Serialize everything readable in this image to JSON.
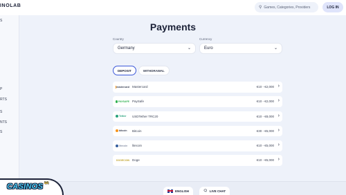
{
  "header": {
    "logo_text": "INOLAB",
    "search_placeholder": "Games, Categories, Providers",
    "search_icon": "search-icon",
    "login_label": "LOG IN"
  },
  "sidebar": {
    "fragments": [
      "S",
      "P",
      "RTS",
      "S",
      "NTS",
      "S"
    ]
  },
  "main": {
    "title": "Payments",
    "country_label": "Country",
    "country_value": "Germany",
    "currency_label": "Currency",
    "currency_value": "Euro",
    "tabs": [
      {
        "label": "DEPOSIT",
        "active": true
      },
      {
        "label": "WITHDRAWAL",
        "active": false
      }
    ],
    "methods": [
      {
        "logo": "mastercard",
        "name": "Mastercard",
        "limits": "€10 - €2,000",
        "color": "#eb001b"
      },
      {
        "logo": "PAYSAFE",
        "name": "PaySafe",
        "limits": "€10 - €2,000",
        "color": "#2fb14f"
      },
      {
        "logo": "Tether",
        "name": "USDTether TRC20",
        "limits": "€10 - €8,000",
        "color": "#26a17b"
      },
      {
        "logo": "bitcoin",
        "name": "Bitcoin",
        "limits": "€30 - €5,000",
        "color": "#f7931a"
      },
      {
        "logo": "litecoin",
        "name": "litecoin",
        "limits": "€10 - €5,000",
        "color": "#345d9d"
      },
      {
        "logo": "DOGECOIN",
        "name": "Doge",
        "limits": "€10 - €5,000",
        "color": "#c2a633"
      }
    ]
  },
  "footer": {
    "language_label": "ENGLISH",
    "chat_label": "LIVE CHAT",
    "brand_word": "CASINOS",
    "brand_suffix": "ac"
  }
}
